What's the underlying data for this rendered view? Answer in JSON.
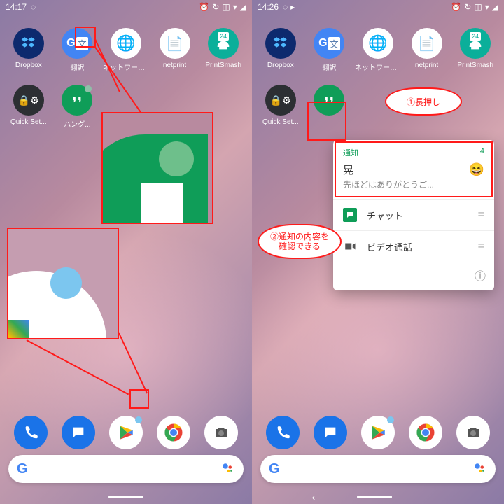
{
  "left": {
    "time": "14:17",
    "apps_row1": [
      {
        "label": "Dropbox",
        "cls": "dropbox"
      },
      {
        "label": "翻訳",
        "cls": "translate"
      },
      {
        "label": "ネットワークフ...",
        "cls": "netfw"
      },
      {
        "label": "netprint",
        "cls": "netprint"
      },
      {
        "label": "PrintSmash",
        "cls": "printsmash"
      }
    ],
    "apps_row2": [
      {
        "label": "Quick Set...",
        "cls": "quickset"
      },
      {
        "label": "ハング...",
        "cls": "hangouts",
        "dot": "#8fbfa8"
      }
    ]
  },
  "right": {
    "time": "14:26",
    "apps_row1": [
      {
        "label": "Dropbox",
        "cls": "dropbox"
      },
      {
        "label": "翻訳",
        "cls": "translate"
      },
      {
        "label": "ネットワークフ...",
        "cls": "netfw"
      },
      {
        "label": "netprint",
        "cls": "netprint"
      },
      {
        "label": "PrintSmash",
        "cls": "printsmash"
      }
    ],
    "apps_row2": [
      {
        "label": "Quick Set...",
        "cls": "quickset"
      },
      {
        "label": "",
        "cls": "hangouts",
        "boxed": true
      }
    ],
    "callout1": "①長押し",
    "callout2_l1": "②通知の内容を",
    "callout2_l2": "確認できる",
    "popup": {
      "header": "通知",
      "count": "4",
      "name": "晃",
      "snippet": "先ほどはありがとうご...",
      "row1": "チャット",
      "row2": "ビデオ通話"
    }
  },
  "iconText": {
    "dropbox": "⬡",
    "translateA": "G",
    "translateB": "文",
    "netfw": "🗂",
    "netprint": "📄",
    "printsmash": "24",
    "quickset": "⚙",
    "hangouts": "❝❞",
    "phone": "✆",
    "messages": "💬",
    "chrome": "◉",
    "camera": "📷"
  }
}
